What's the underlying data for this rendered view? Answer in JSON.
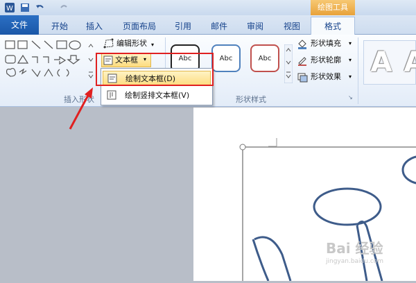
{
  "titlebar": {
    "drawing_tools": "绘图工具"
  },
  "tabs": {
    "file": "文件",
    "items": [
      "开始",
      "插入",
      "页面布局",
      "引用",
      "邮件",
      "审阅",
      "视图"
    ],
    "format": "格式"
  },
  "ribbon": {
    "edit_shape": "编辑形状",
    "text_box": "文本框",
    "insert_shapes_group": "插入形状",
    "shape_styles_group": "形状样式",
    "style_samples": [
      "Abc",
      "Abc",
      "Abc"
    ],
    "shape_fill": "形状填充",
    "shape_outline": "形状轮廓",
    "shape_effects": "形状效果",
    "wordart": [
      "A",
      "A"
    ]
  },
  "dropdown": {
    "draw_textbox": "绘制文本框(D)",
    "draw_vertical_textbox": "绘制竖排文本框(V)"
  },
  "watermark": {
    "main": "Bai 经验",
    "sub": "jingyan.baidu.com"
  },
  "colors": {
    "file_tab": "#1a57a8",
    "drawing_tools": "#e8a23a",
    "highlight": "#e02020",
    "arrow": "#e02020"
  }
}
